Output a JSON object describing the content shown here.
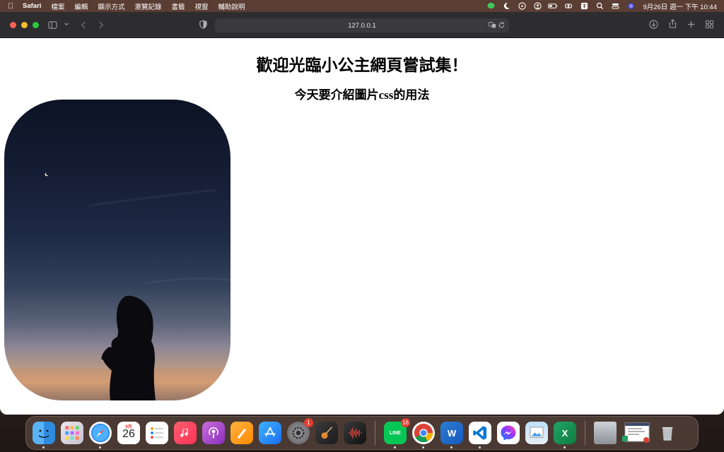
{
  "menubar": {
    "app_name": "Safari",
    "items": [
      "檔案",
      "編輯",
      "顯示方式",
      "瀏覽記錄",
      "書籤",
      "視窗",
      "輔助說明"
    ],
    "clock": "9月26日 週一 下午 10:44"
  },
  "browser": {
    "url": "127.0.0.1"
  },
  "page": {
    "heading": "歡迎光臨小公主網頁嘗試集！",
    "subheading": "今天要介紹圖片css的用法"
  },
  "dock": {
    "calendar_month": "9月",
    "calendar_day": "26",
    "settings_badge": "1",
    "line_badge": "16",
    "line_label": "LINE",
    "word_label": "W",
    "excel_label": "X"
  },
  "colors": {
    "menubar_bg": "#5a3d33",
    "toolbar_bg": "#2d2d2f",
    "traffic_red": "#ff5f57",
    "traffic_yellow": "#febc2e",
    "traffic_green": "#28c840"
  }
}
